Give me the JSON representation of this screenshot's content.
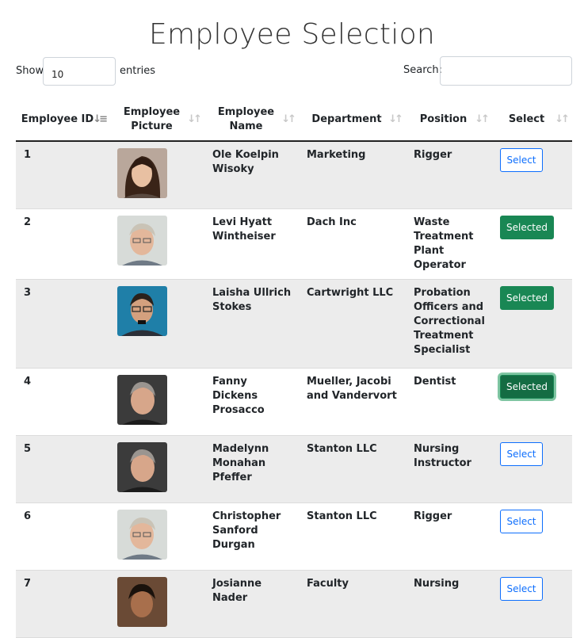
{
  "page": {
    "title": "Employee Selection"
  },
  "length_control": {
    "show_label": "Show",
    "value": "10",
    "entries_label": "entries"
  },
  "search": {
    "label": "Search:",
    "value": ""
  },
  "table": {
    "headers": [
      {
        "label": "Employee ID",
        "sort": "desc"
      },
      {
        "label": "Employee Picture",
        "sort": "none"
      },
      {
        "label": "Employee Name",
        "sort": "none"
      },
      {
        "label": "Department",
        "sort": "none"
      },
      {
        "label": "Position",
        "sort": "none"
      },
      {
        "label": "Select",
        "sort": "none"
      }
    ],
    "rows": [
      {
        "id": "1",
        "name": "Ole Koelpin Wisoky",
        "department": "Marketing",
        "position": "Rigger",
        "button": "Select"
      },
      {
        "id": "2",
        "name": "Levi Hyatt Wintheiser",
        "department": "Dach Inc",
        "position": "Waste Treatment Plant Operator",
        "button": "Selected"
      },
      {
        "id": "3",
        "name": "Laisha Ullrich Stokes",
        "department": "Cartwright LLC",
        "position": "Probation Officers and Correctional Treatment Specialist",
        "button": "Selected"
      },
      {
        "id": "4",
        "name": "Fanny Dickens Prosacco",
        "department": "Mueller, Jacobi and Vandervort",
        "position": "Dentist",
        "button": "Selected"
      },
      {
        "id": "5",
        "name": "Madelynn Monahan Pfeffer",
        "department": "Stanton LLC",
        "position": "Nursing Instructor",
        "button": "Select"
      },
      {
        "id": "6",
        "name": "Christopher Sanford Durgan",
        "department": "Stanton LLC",
        "position": "Rigger",
        "button": "Select"
      },
      {
        "id": "7",
        "name": "Josianne Nader",
        "department": "Faculty",
        "position": "Nursing",
        "button": "Select"
      }
    ]
  },
  "colors": {
    "select_border": "#0d6efd",
    "selected_bg": "#198754",
    "row_stripe": "#ececec"
  }
}
